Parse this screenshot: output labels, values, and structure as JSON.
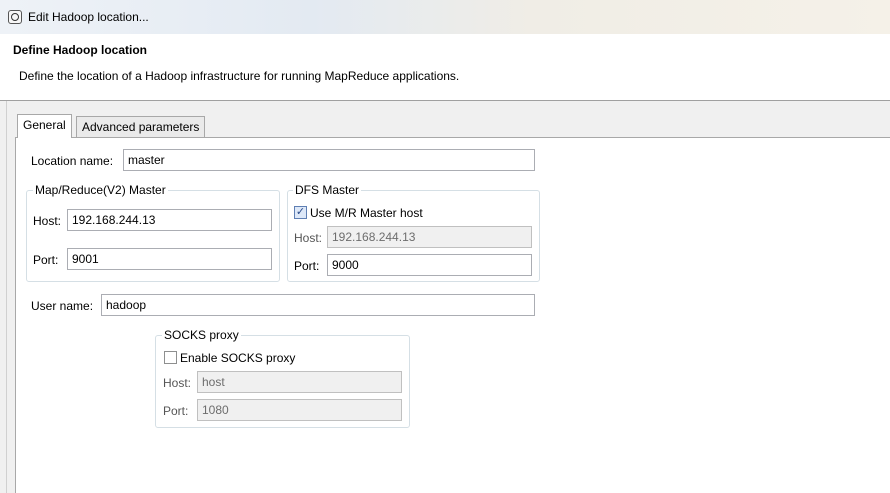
{
  "window": {
    "title": "Edit Hadoop location..."
  },
  "header": {
    "title": "Define Hadoop location",
    "description": "Define the location of a Hadoop infrastructure for running MapReduce applications."
  },
  "tabs": [
    {
      "label": "General",
      "active": true
    },
    {
      "label": "Advanced parameters",
      "active": false
    }
  ],
  "general": {
    "location_name_label": "Location name:",
    "location_name_value": "master",
    "mapreduce": {
      "legend": "Map/Reduce(V2) Master",
      "host_label": "Host:",
      "host_value": "192.168.244.13",
      "port_label": "Port:",
      "port_value": "9001"
    },
    "dfs": {
      "legend": "DFS Master",
      "use_mr_host_label": "Use M/R Master host",
      "use_mr_host_checked": true,
      "host_label": "Host:",
      "host_value": "192.168.244.13",
      "port_label": "Port:",
      "port_value": "9000"
    },
    "user_name_label": "User name:",
    "user_name_value": "hadoop",
    "socks": {
      "legend": "SOCKS proxy",
      "enable_label": "Enable SOCKS proxy",
      "enable_checked": false,
      "host_label": "Host:",
      "host_value": "host",
      "port_label": "Port:",
      "port_value": "1080"
    }
  }
}
